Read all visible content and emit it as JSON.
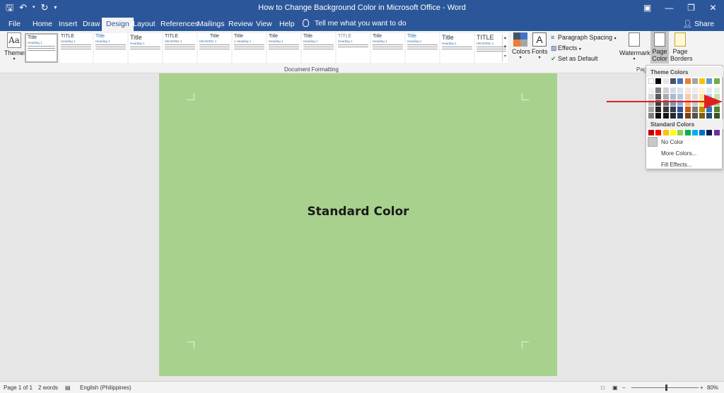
{
  "window": {
    "title": "How to Change Background Color in Microsoft Office  -  Word",
    "controls": [
      "ribbon-display-icon",
      "minimize-icon",
      "restore-icon",
      "close-icon"
    ]
  },
  "quick_access": [
    "save-icon",
    "undo-icon",
    "redo-icon",
    "customize-icon"
  ],
  "tabs": [
    "File",
    "Home",
    "Insert",
    "Draw",
    "Design",
    "Layout",
    "References",
    "Mailings",
    "Review",
    "View",
    "Help"
  ],
  "active_tab": "Design",
  "tell_me": "Tell me what you want to do",
  "share": "Share",
  "ribbon": {
    "themes_label": "Themes",
    "themes_glyph": "Aa",
    "style_gallery": [
      {
        "title": "Title",
        "heading": "Heading 1"
      },
      {
        "title": "TITLE",
        "heading": "Heading 1"
      },
      {
        "title": "Title",
        "heading": "Heading 1"
      },
      {
        "title": "Title",
        "heading": "Heading 1"
      },
      {
        "title": "TITLE",
        "heading": "HEADING 1"
      },
      {
        "title": "Title",
        "heading": "HEADING 1"
      },
      {
        "title": "Title",
        "heading": "1   Heading 1"
      },
      {
        "title": "Title",
        "heading": "Heading 1"
      },
      {
        "title": "Title",
        "heading": "Heading 1"
      },
      {
        "title": "TITLE",
        "heading": "Heading 1"
      },
      {
        "title": "Title",
        "heading": "Heading 1"
      },
      {
        "title": "Title",
        "heading": "Heading 1"
      },
      {
        "title": "Title",
        "heading": "Heading 1"
      },
      {
        "title": "TITLE",
        "heading": "HEADING 1"
      }
    ],
    "group_label": "Document Formatting",
    "colors_label": "Colors",
    "fonts_label": "Fonts",
    "fonts_glyph": "A",
    "paragraph_spacing": "Paragraph Spacing",
    "effects": "Effects",
    "set_as_default": "Set as Default",
    "watermark": "Watermark",
    "page_color": [
      "Page",
      "Color"
    ],
    "page_borders": [
      "Page",
      "Borders"
    ],
    "page_bg_group_partial": "Pag"
  },
  "dropdown": {
    "theme_colors_header": "Theme Colors",
    "standard_colors_header": "Standard Colors",
    "theme_top_row": [
      "#ffffff",
      "#000000",
      "#e7e6e6",
      "#44546a",
      "#4472c4",
      "#ed7d31",
      "#a5a5a5",
      "#ffc000",
      "#5b9bd5",
      "#70ad47"
    ],
    "theme_shades": [
      [
        "#f2f2f2",
        "#7f7f7f",
        "#d0cece",
        "#d6dce4",
        "#d9e2f3",
        "#fbe4d5",
        "#ededed",
        "#fff2cc",
        "#deebf6",
        "#e2efd9"
      ],
      [
        "#d8d8d8",
        "#595959",
        "#aeabab",
        "#adb9ca",
        "#b4c6e7",
        "#f7cbac",
        "#dbdbdb",
        "#fee599",
        "#bdd7ee",
        "#c5e0b3"
      ],
      [
        "#bfbfbf",
        "#3f3f3f",
        "#757070",
        "#8496b0",
        "#8eaadb",
        "#f4b183",
        "#c9c9c9",
        "#ffd965",
        "#9dc3e6",
        "#a8d08d"
      ],
      [
        "#a5a5a5",
        "#262626",
        "#3a3838",
        "#323f4f",
        "#2f5496",
        "#c55a11",
        "#7b7b7b",
        "#bf8f00",
        "#2e75b5",
        "#538135"
      ],
      [
        "#7f7f7f",
        "#0c0c0c",
        "#171616",
        "#222a35",
        "#1f3864",
        "#833c0b",
        "#525252",
        "#7f6000",
        "#1f4e79",
        "#375623"
      ]
    ],
    "standard_colors": [
      "#c00000",
      "#ff0000",
      "#ffc000",
      "#ffff00",
      "#92d050",
      "#00b050",
      "#00b0f0",
      "#0070c0",
      "#002060",
      "#7030a0"
    ],
    "no_color": "No Color",
    "more_colors": "More Colors...",
    "fill_effects": "Fill Effects..."
  },
  "document": {
    "page_color": "#a9d18e",
    "text": "Standard Color"
  },
  "annotation": {
    "arrow_color": "#e02020"
  },
  "status": {
    "page": "Page 1 of 1",
    "words": "2 words",
    "language": "English (Philippines)",
    "zoom": "80%",
    "zoom_fraction": 0.52
  }
}
